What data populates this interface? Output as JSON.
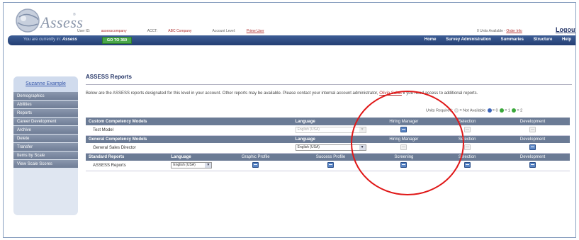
{
  "header": {
    "logo_text": "Assess",
    "logo_tm": "®",
    "user_id_label": "User ID:",
    "user_id": "assesscompany",
    "acct_label": "ACCT:",
    "acct": "ABC Company",
    "level_label": "Account Level:",
    "level": "Prime User",
    "units_text": "0 Units Available -",
    "order_link": "Order Info",
    "logout": "Logout"
  },
  "navbar": {
    "location_prefix": "You are currently in:",
    "location": "Assess",
    "goto_button": "GO TO 360",
    "links": [
      "Home",
      "Survey Administration",
      "Summaries",
      "Structure",
      "Help"
    ]
  },
  "sidebar": {
    "user_name": "Suzanne Example",
    "items": [
      "Demographics",
      "Abilities",
      "Reports",
      "Career Development",
      "Archive",
      "Delete",
      "Transfer",
      "Items by Scale",
      "View Scale Scores"
    ]
  },
  "main": {
    "title": "ASSESS Reports",
    "desc_before": "Below are the ASSESS reports designated for this level in your account. Other reports may be available. Please contact your internal account administrator,",
    "desc_link": "Olivia Salas",
    "desc_after": "if you need access to additional reports.",
    "legend_units": "Units Required:",
    "legend_na": "= Not Available",
    "legend_0": "= 0",
    "legend_1": "= 1",
    "legend_2": "= 2",
    "colors": {
      "units0": "#3a63b8",
      "units1": "#3aa83a",
      "units2": "#3aa83a",
      "circle": "#e01818"
    }
  },
  "table": {
    "custom": {
      "header": "Custom Competency Models",
      "language_header": "Language",
      "cols": [
        "Hiring Manager",
        "Selection",
        "Development"
      ],
      "row_name": "Test Model",
      "language": "English (USA)"
    },
    "general": {
      "header": "General Competency Models",
      "language_header": "Language",
      "cols": [
        "Hiring Manager",
        "Selection",
        "Development"
      ],
      "row_name": "General Sales Director",
      "language": "English (USA)"
    },
    "standard": {
      "header": "Standard Reports",
      "language_header": "Language",
      "cols": [
        "Graphic Profile",
        "Success Profile",
        "Screening",
        "Selection",
        "Development"
      ],
      "row_name": "ASSESS Reports",
      "language": "English (USA)"
    }
  },
  "dropdown_arrow": "▼"
}
